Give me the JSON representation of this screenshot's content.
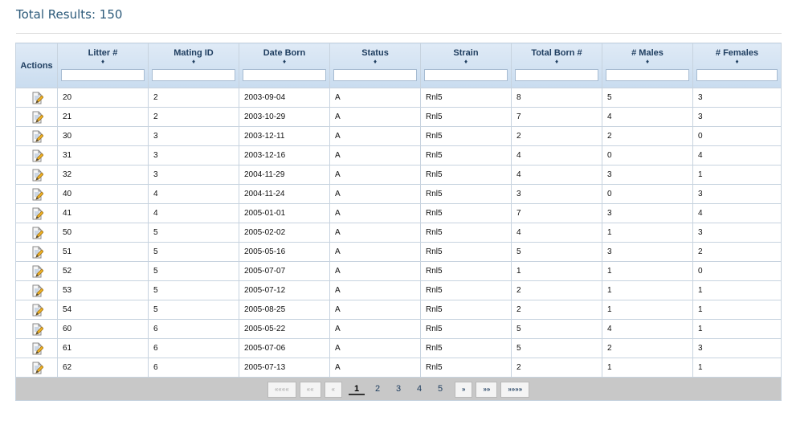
{
  "summary": {
    "total_results": "Total Results: 150"
  },
  "table": {
    "actions_header": "Actions",
    "sort_glyph": "♦",
    "columns": [
      {
        "label": "Litter #",
        "key": "litter"
      },
      {
        "label": "Mating ID",
        "key": "mating"
      },
      {
        "label": "Date Born",
        "key": "date"
      },
      {
        "label": "Status",
        "key": "status"
      },
      {
        "label": "Strain",
        "key": "strain"
      },
      {
        "label": "Total Born #",
        "key": "total"
      },
      {
        "label": "# Males",
        "key": "males"
      },
      {
        "label": "# Females",
        "key": "females"
      }
    ],
    "rows": [
      [
        "20",
        "2",
        "2003-09-04",
        "A",
        "Rnl5",
        "8",
        "5",
        "3"
      ],
      [
        "21",
        "2",
        "2003-10-29",
        "A",
        "Rnl5",
        "7",
        "4",
        "3"
      ],
      [
        "30",
        "3",
        "2003-12-11",
        "A",
        "Rnl5",
        "2",
        "2",
        "0"
      ],
      [
        "31",
        "3",
        "2003-12-16",
        "A",
        "Rnl5",
        "4",
        "0",
        "4"
      ],
      [
        "32",
        "3",
        "2004-11-29",
        "A",
        "Rnl5",
        "4",
        "3",
        "1"
      ],
      [
        "40",
        "4",
        "2004-11-24",
        "A",
        "Rnl5",
        "3",
        "0",
        "3"
      ],
      [
        "41",
        "4",
        "2005-01-01",
        "A",
        "Rnl5",
        "7",
        "3",
        "4"
      ],
      [
        "50",
        "5",
        "2005-02-02",
        "A",
        "Rnl5",
        "4",
        "1",
        "3"
      ],
      [
        "51",
        "5",
        "2005-05-16",
        "A",
        "Rnl5",
        "5",
        "3",
        "2"
      ],
      [
        "52",
        "5",
        "2005-07-07",
        "A",
        "Rnl5",
        "1",
        "1",
        "0"
      ],
      [
        "53",
        "5",
        "2005-07-12",
        "A",
        "Rnl5",
        "2",
        "1",
        "1"
      ],
      [
        "54",
        "5",
        "2005-08-25",
        "A",
        "Rnl5",
        "2",
        "1",
        "1"
      ],
      [
        "60",
        "6",
        "2005-05-22",
        "A",
        "Rnl5",
        "5",
        "4",
        "1"
      ],
      [
        "61",
        "6",
        "2005-07-06",
        "A",
        "Rnl5",
        "5",
        "2",
        "3"
      ],
      [
        "62",
        "6",
        "2005-07-13",
        "A",
        "Rnl5",
        "2",
        "1",
        "1"
      ]
    ]
  },
  "pager": {
    "first": "««««",
    "prev_block": "««",
    "prev": "«",
    "pages": [
      "1",
      "2",
      "3",
      "4",
      "5"
    ],
    "current_page": "1",
    "next": "»",
    "next_block": "»»",
    "last": "»»»»"
  },
  "icons": {
    "row_action": "edit-document-icon"
  },
  "colors": {
    "header_text": "#1f3e60",
    "title": "#2c5a7a",
    "pager_bar": "#c8c8c8",
    "grid_border": "#c7d3df"
  }
}
